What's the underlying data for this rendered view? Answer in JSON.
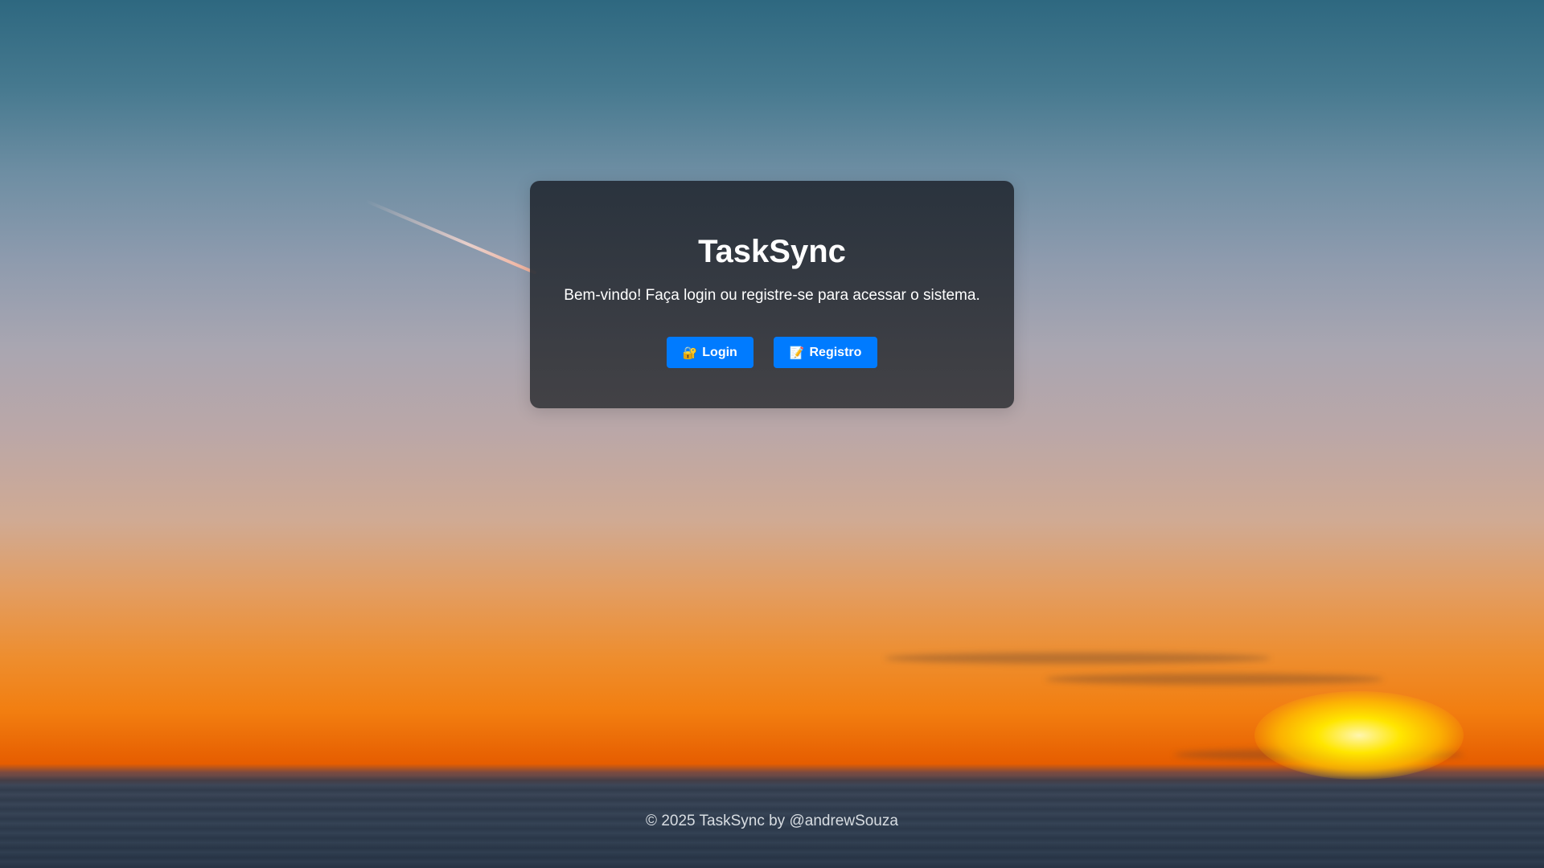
{
  "app": {
    "title": "TaskSync",
    "welcome_text": "Bem-vindo! Faça login ou registre-se para acessar o sistema."
  },
  "buttons": {
    "login": {
      "icon": "lock-key-icon",
      "glyph": "🔐",
      "label": "Login"
    },
    "register": {
      "icon": "memo-icon",
      "glyph": "📝",
      "label": "Registro"
    }
  },
  "footer": {
    "text": "© 2025 TaskSync by @andrewSouza"
  },
  "colors": {
    "button_primary": "#007bff",
    "card_background": "#2e3540",
    "text": "#ffffff"
  }
}
